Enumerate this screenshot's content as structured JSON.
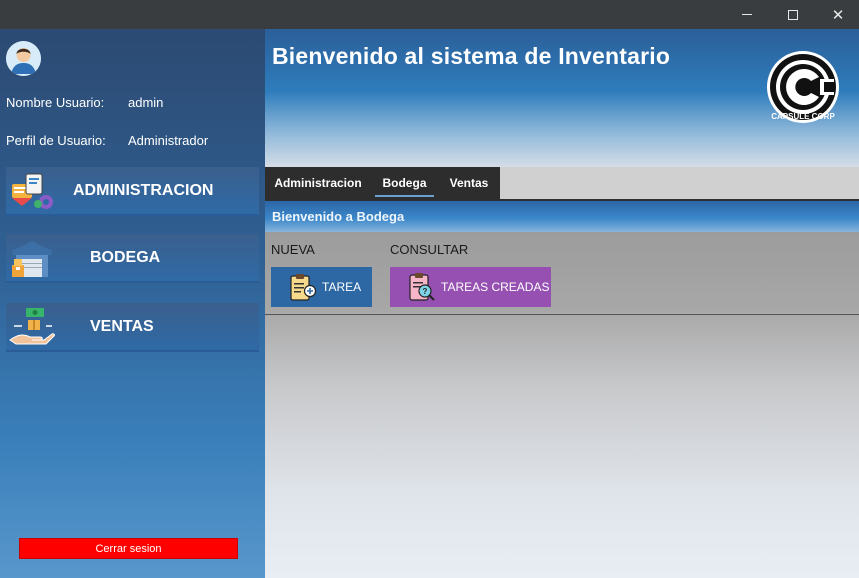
{
  "window": {
    "controls": {
      "minimize_icon": "minimize-icon",
      "maximize_icon": "maximize-icon",
      "close_icon": "close-icon",
      "close_glyph": "✕"
    }
  },
  "sidebar": {
    "avatar_icon": "user-avatar-icon",
    "user_label": "Nombre Usuario:",
    "user_value": "admin",
    "profile_label": "Perfil de Usuario:",
    "profile_value": "Administrador",
    "menu": [
      {
        "label": "ADMINISTRACION",
        "icon": "administration-icon"
      },
      {
        "label": "BODEGA",
        "icon": "warehouse-icon"
      },
      {
        "label": "VENTAS",
        "icon": "sales-icon"
      }
    ],
    "logout_label": "Cerrar sesion"
  },
  "header": {
    "title": "Bienvenido al sistema  de Inventario",
    "logo_icon": "capsule-corp-logo",
    "logo_text": "CAPSULE CORP"
  },
  "tabs": {
    "items": [
      "Administracion",
      "Bodega",
      "Ventas"
    ],
    "active": "Bodega"
  },
  "bodega": {
    "title": "Bienvenido a Bodega",
    "new_label": "NUEVA",
    "query_label": "CONSULTAR",
    "tarea_button": "TAREA",
    "tareas_button": "TAREAS CREADAS",
    "tarea_icon": "new-task-clipboard-icon",
    "tareas_icon": "search-task-clipboard-icon"
  },
  "colors": {
    "sidebar_gradient_top": "#2c4a72",
    "sidebar_gradient_bottom": "#5897cc",
    "logout": "#ff0000",
    "tarea_button": "#2d67a4",
    "tareas_button": "#9650b2",
    "tab_bg": "#2d2d2d"
  }
}
